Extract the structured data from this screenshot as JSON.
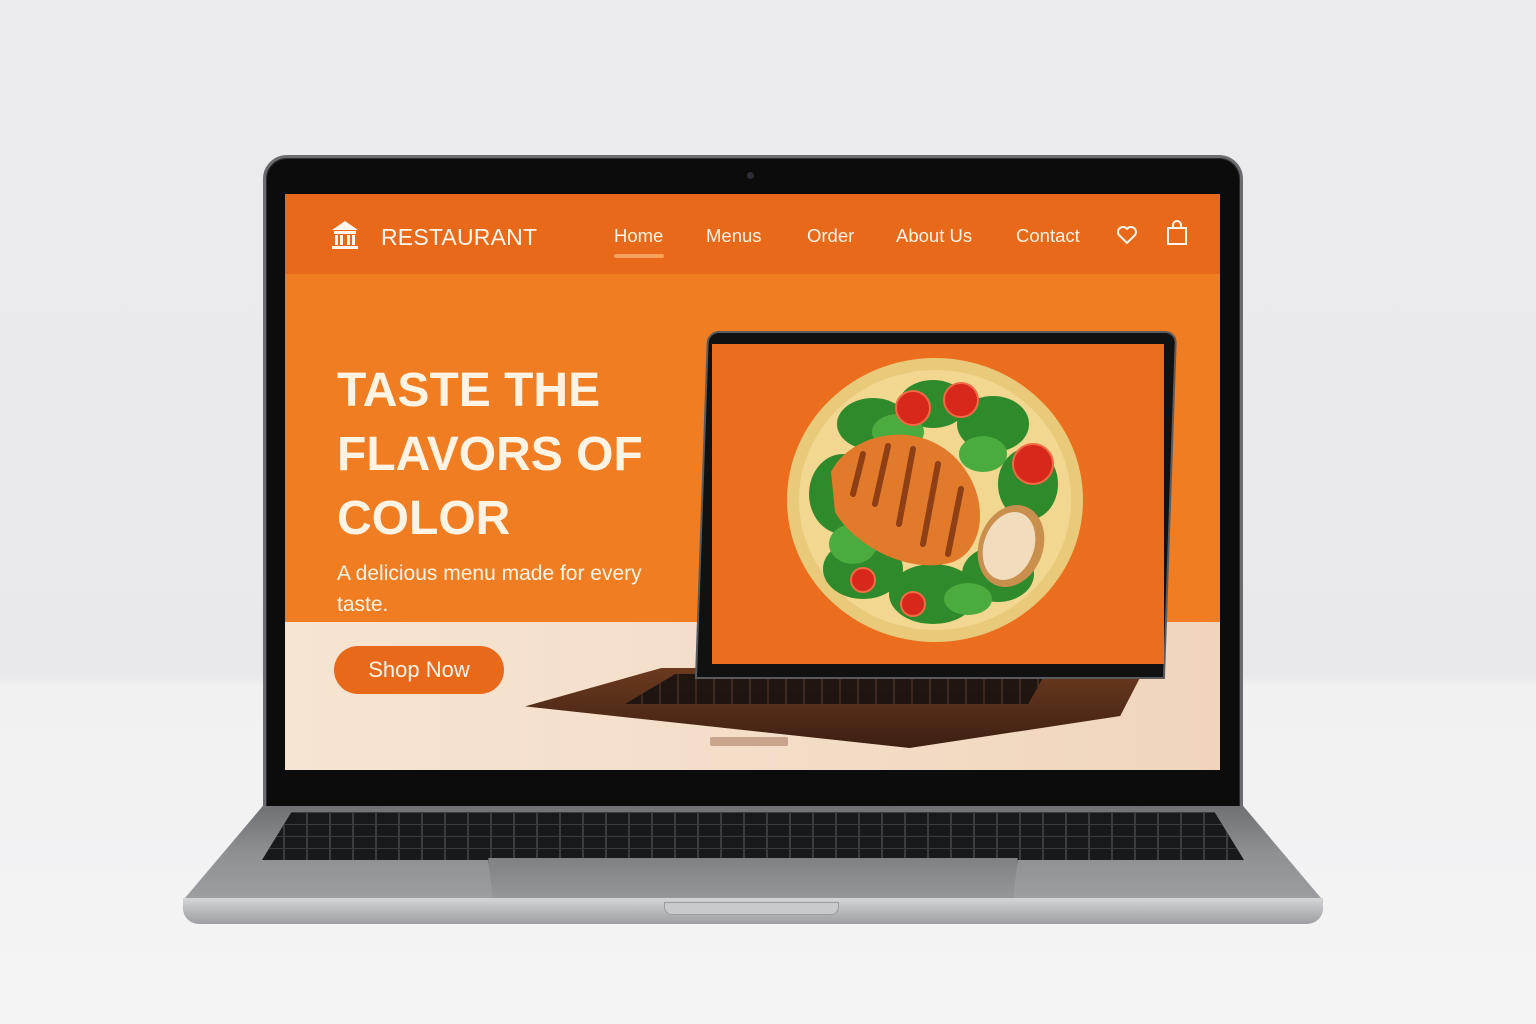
{
  "site": {
    "brand": "RESTAURANT",
    "nav": [
      "Home",
      "Menus",
      "Order",
      "About Us",
      "Contact"
    ],
    "active_nav": "Home"
  },
  "hero": {
    "headline": "TASTE THE FLAVORS OF COLOR",
    "subline": "A delicious menu made for every taste.",
    "cta_label": "Shop Now"
  },
  "icons": {
    "logo": "restaurant-building-icon",
    "wishlist": "heart-icon",
    "cart": "shopping-bag-icon"
  },
  "colors": {
    "accent": "#e8691a",
    "hero_bg": "#f07d22",
    "cream": "#f6e5d2",
    "text_light": "#fff3e4"
  }
}
